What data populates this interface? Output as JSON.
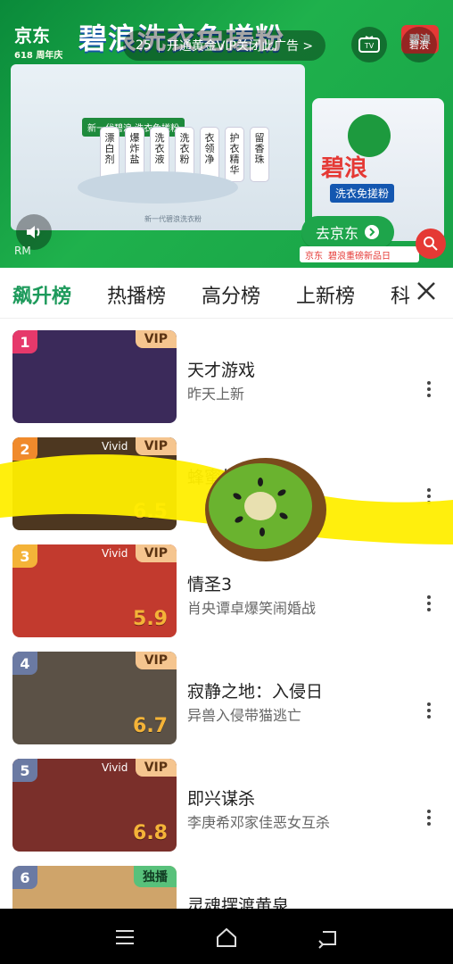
{
  "ad": {
    "jd_logo": "京东",
    "jd_sub": "618 周年庆",
    "title": "碧浪洗衣免搓粉",
    "brand": "碧浪",
    "counter": "25",
    "counter_text": "开通黄金VIP关闭此广告 >",
    "tv_label": "TV",
    "brand_btn": "碧浪",
    "bottles": [
      "漂白剂",
      "爆炸盐",
      "洗衣液",
      "洗衣粉",
      "衣领净",
      "护衣精华",
      "留香珠"
    ],
    "tag": "新一代碧浪 洗衣免搓粉",
    "small": "新一代碧浪洗衣粉",
    "product_name": "碧浪",
    "product_sub": "洗衣免搓粉",
    "goto_label": "去京东",
    "goto_icon": "chevron-right-icon",
    "rm": "RM",
    "jd_strip_left": "京东",
    "jd_strip_right": "碧浪重磅新品日"
  },
  "tabs": {
    "items": [
      "飙升榜",
      "热播榜",
      "高分榜",
      "上新榜",
      "科"
    ],
    "active_index": 0,
    "active_color": "#1d9a5b"
  },
  "list": [
    {
      "rank": "1",
      "rank_color": "#e6396b",
      "badge": "VIP",
      "vivid": "",
      "score": "",
      "title": "天才游戏",
      "subtitle": "昨天上新",
      "thumb_color": "#3b2a5a"
    },
    {
      "rank": "2",
      "rank_color": "#f08a2c",
      "badge": "VIP",
      "vivid": "Vivid",
      "score": "6.5",
      "title": "蜂蜜的",
      "subtitle": "",
      "thumb_color": "#4d3720"
    },
    {
      "rank": "3",
      "rank_color": "#f4b338",
      "badge": "VIP",
      "vivid": "Vivid",
      "score": "5.9",
      "title": "情圣3",
      "subtitle": "肖央谭卓爆笑闹婚战",
      "thumb_color": "#c23a2e"
    },
    {
      "rank": "4",
      "rank_color": "#6b7aa3",
      "badge": "VIP",
      "vivid": "",
      "score": "6.7",
      "title": "寂静之地：入侵日",
      "subtitle": "异兽入侵带猫逃亡",
      "thumb_color": "#5b5146"
    },
    {
      "rank": "5",
      "rank_color": "#6b7aa3",
      "badge": "VIP",
      "vivid": "Vivid",
      "score": "6.8",
      "title": "即兴谋杀",
      "subtitle": "李庚希邓家佳恶女互杀",
      "thumb_color": "#7a2f2a"
    },
    {
      "rank": "6",
      "rank_color": "#6b7aa3",
      "badge": "独播",
      "vivid": "",
      "score": "",
      "title": "灵魂摆渡黄泉",
      "subtitle": "",
      "thumb_color": "#cfa46a"
    }
  ],
  "colors": {
    "vip_bg": "#f5c58f",
    "exclusive_bg": "#58c17b"
  }
}
